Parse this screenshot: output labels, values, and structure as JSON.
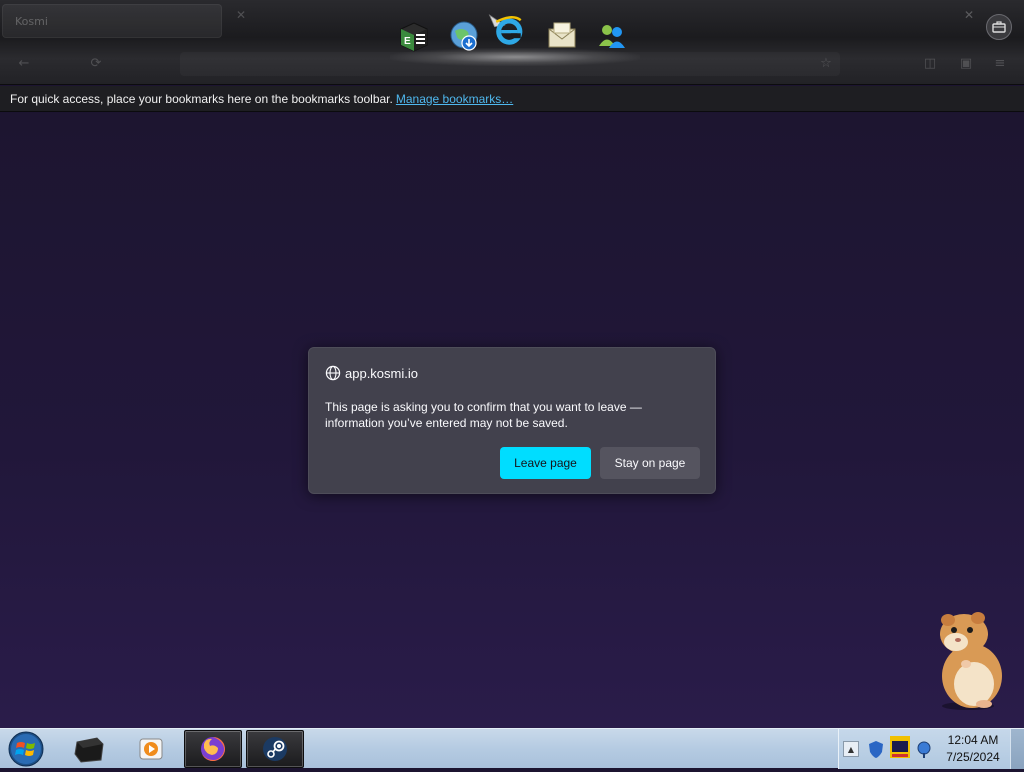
{
  "browser": {
    "tab_title": "Kosmi",
    "bookmarks_toolbar": {
      "message": "For quick access, place your bookmarks here on the bookmarks toolbar.",
      "link_label": "Manage bookmarks…"
    },
    "dock_icons": [
      "spreadsheet-icon",
      "internet-globe-icon",
      "internet-explorer-icon",
      "mail-icon",
      "messenger-icon"
    ]
  },
  "dialog": {
    "origin": "app.kosmi.io",
    "message": "This page is asking you to confirm that you want to leave — information you’ve entered may not be saved.",
    "leave_label": "Leave page",
    "stay_label": "Stay on page"
  },
  "taskbar": {
    "apps": [
      "dark-app-icon",
      "media-player-icon",
      "firefox-icon",
      "steam-icon"
    ],
    "clock_time": "12:04 AM",
    "clock_date": "7/25/2024"
  },
  "colors": {
    "accent": "#00ddff",
    "dialog_bg": "#42414d",
    "link": "#4fb8ee",
    "page_bg": "#21173a"
  }
}
